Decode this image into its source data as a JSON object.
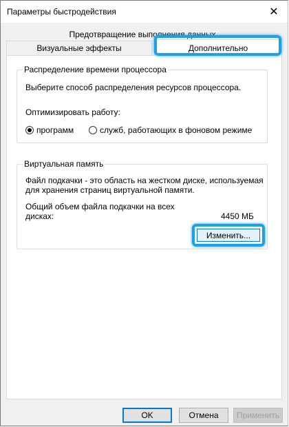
{
  "window": {
    "title": "Параметры быстродействия",
    "close_glyph": "✕"
  },
  "tabs": {
    "row2_label": "Предотвращение выполнения данных",
    "visual_label": "Визуальные эффекты",
    "advanced_label": "Дополнительно"
  },
  "cpu": {
    "legend": "Распределение времени процессора",
    "description": "Выберите способ распределения ресурсов процессора.",
    "optimize_label": "Оптимизировать работу:",
    "option_programs": "программ",
    "option_services": "служб, работающих в фоновом режиме",
    "selected": "программ"
  },
  "virtual_memory": {
    "legend": "Виртуальная память",
    "description_line1": "Файл подкачки - это область на жестком диске, используемая",
    "description_line2": "для хранения страниц виртуальной памяти.",
    "total_label_line1": "Общий объем файла подкачки на всех",
    "total_label_line2": "дисках:",
    "total_value": "4450 МБ",
    "change_button": "Изменить..."
  },
  "footer": {
    "ok": "OK",
    "cancel": "Отмена",
    "apply": "Применить"
  },
  "colors": {
    "highlight": "#1ea0e6",
    "focus": "#0078d7"
  }
}
